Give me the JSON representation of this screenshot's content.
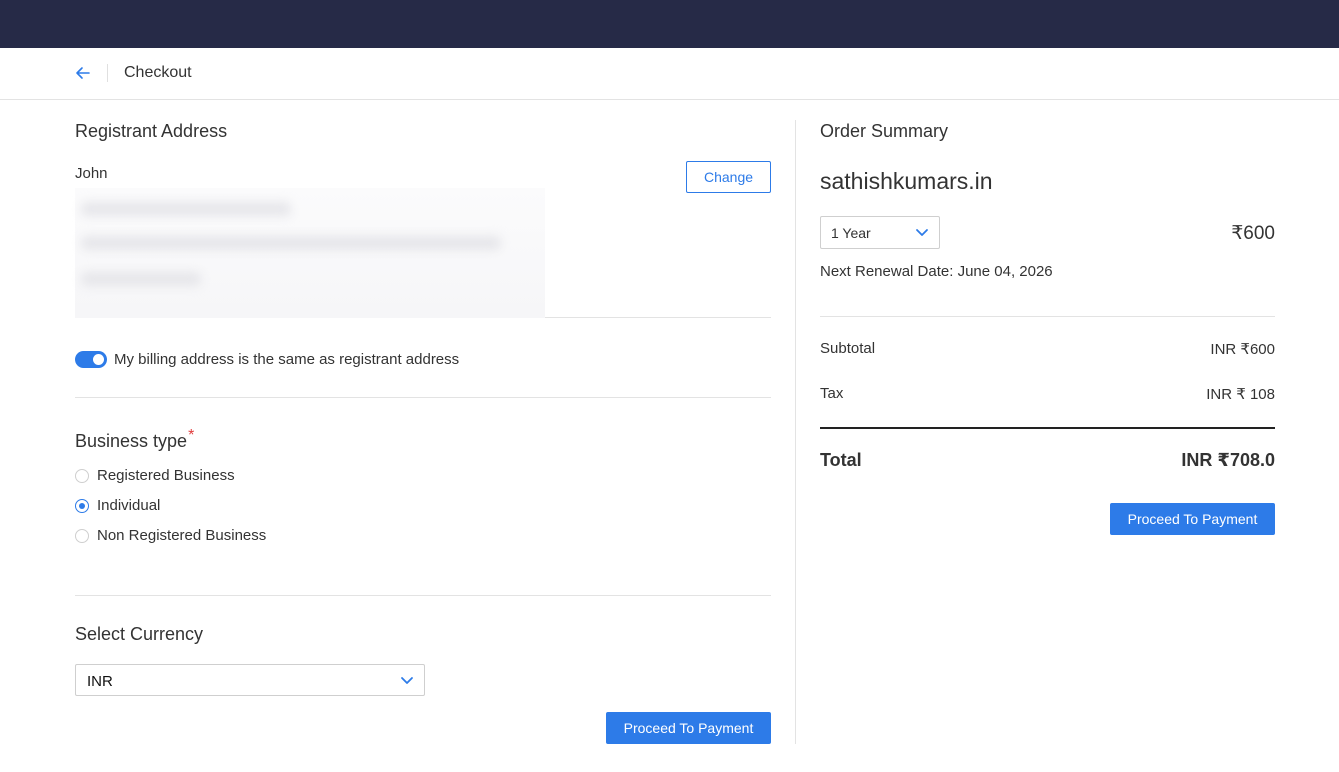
{
  "header": {
    "title": "Checkout"
  },
  "registrant": {
    "heading": "Registrant Address",
    "name": "John",
    "change_label": "Change"
  },
  "billing": {
    "same_as_registrant_label": "My billing address is the same as registrant address",
    "toggle_on": true
  },
  "business_type": {
    "heading": "Business type",
    "required_marker": "*",
    "options": [
      {
        "label": "Registered Business",
        "selected": false
      },
      {
        "label": "Individual",
        "selected": true
      },
      {
        "label": "Non Registered Business",
        "selected": false
      }
    ]
  },
  "currency": {
    "heading": "Select Currency",
    "selected": "INR"
  },
  "proceed_label": "Proceed To Payment",
  "order_summary": {
    "heading": "Order Summary",
    "domain": "sathishkumars.in",
    "term": "1 Year",
    "price": "₹600",
    "renewal": "Next Renewal Date: June 04, 2026",
    "subtotal_label": "Subtotal",
    "subtotal_value": "INR ₹600",
    "tax_label": "Tax",
    "tax_value": "INR ₹ 108",
    "total_label": "Total",
    "total_value": "INR ₹708.0"
  },
  "colors": {
    "topbar": "#262a47",
    "accent": "#2d7be8",
    "required": "#e03b3b"
  }
}
